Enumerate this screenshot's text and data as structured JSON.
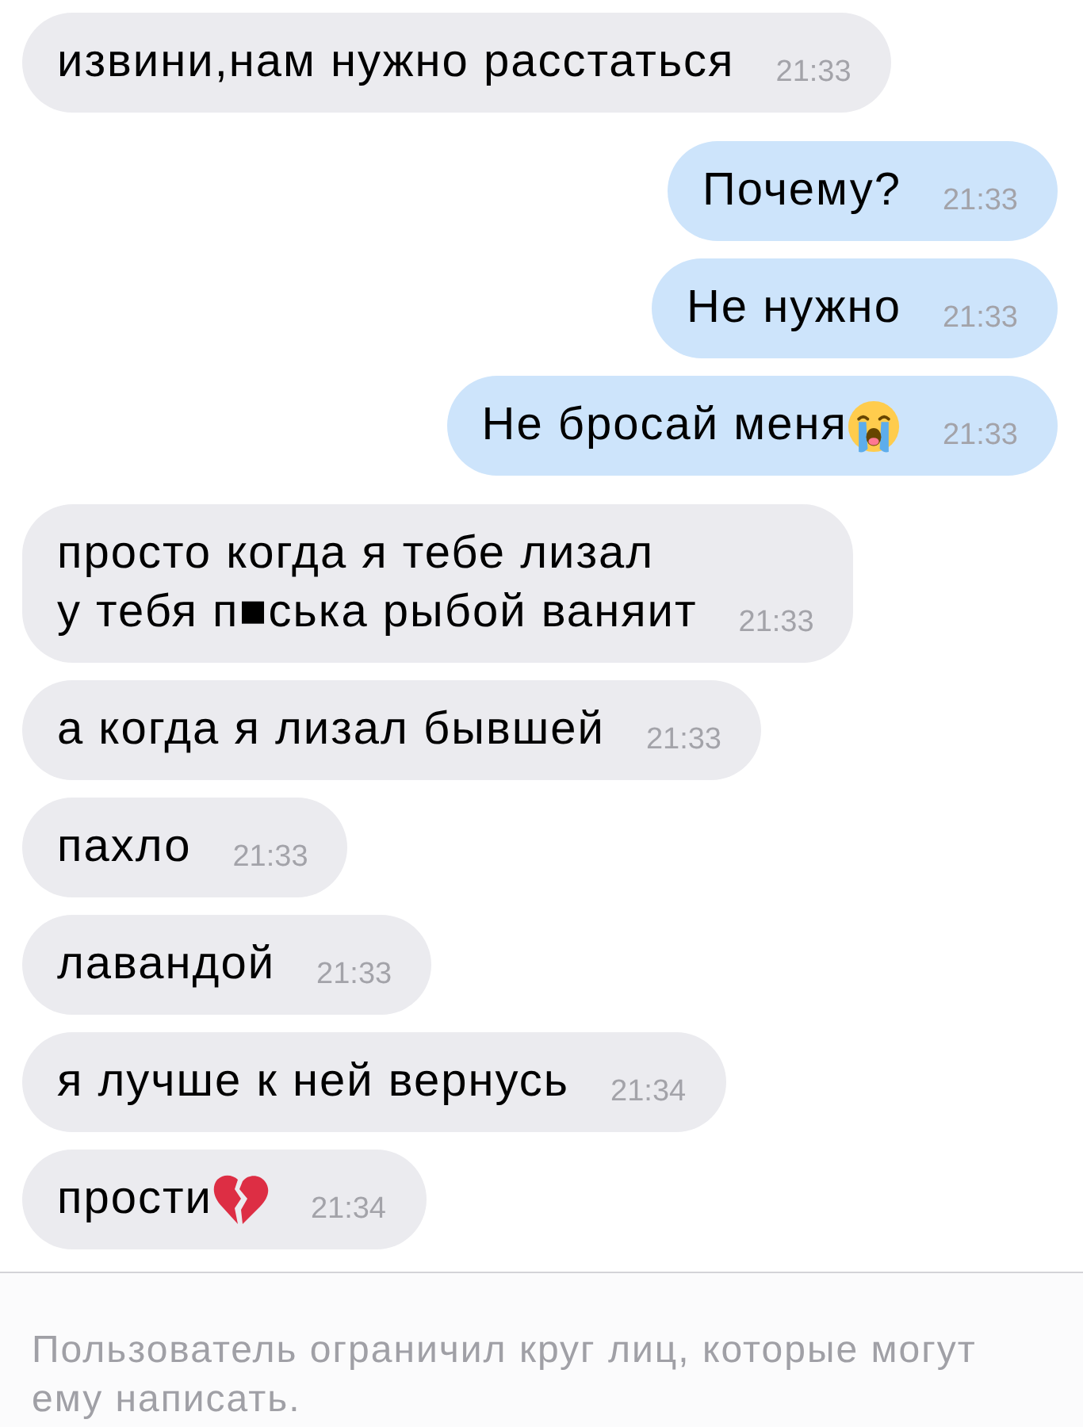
{
  "messages": [
    {
      "outgoing": false,
      "kind": "plain",
      "text": "извини,нам нужно расстаться",
      "time": "21:33"
    },
    {
      "outgoing": true,
      "kind": "plain",
      "text": "Почему?",
      "time": "21:33"
    },
    {
      "outgoing": true,
      "kind": "plain",
      "text": "Не нужно",
      "time": "21:33"
    },
    {
      "outgoing": true,
      "kind": "crying_emoji",
      "text": "Не бросай меня",
      "time": "21:33"
    },
    {
      "outgoing": false,
      "kind": "plain",
      "text": "просто когда я тебе лизал\nу тебя п■ська рыбой ваняит",
      "time": "21:33"
    },
    {
      "outgoing": false,
      "kind": "plain",
      "text": "а когда я лизал бывшей",
      "time": "21:33"
    },
    {
      "outgoing": false,
      "kind": "plain",
      "text": "пахло",
      "time": "21:33"
    },
    {
      "outgoing": false,
      "kind": "plain",
      "text": "лавандой",
      "time": "21:33"
    },
    {
      "outgoing": false,
      "kind": "plain",
      "text": "я лучше к ней вернусь",
      "time": "21:34"
    },
    {
      "outgoing": false,
      "kind": "heart_emoji",
      "text": "прости",
      "time": "21:34"
    }
  ],
  "footer": {
    "notice": "Пользователь ограничил круг лиц, которые могут ему написать."
  }
}
